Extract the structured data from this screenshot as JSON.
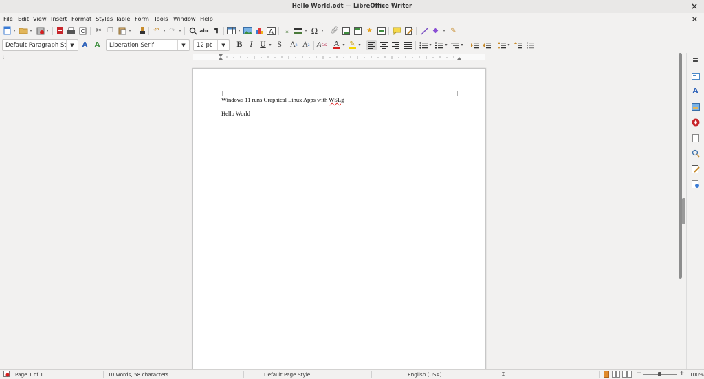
{
  "window": {
    "title": "Hello World.odt — LibreOffice Writer",
    "close_glyph": "×"
  },
  "menu": {
    "items": [
      "File",
      "Edit",
      "View",
      "Insert",
      "Format",
      "Styles",
      "Table",
      "Form",
      "Tools",
      "Window",
      "Help"
    ],
    "doc_close_glyph": "×"
  },
  "toolbar_formatting": {
    "paragraph_style": "Default Paragraph Style",
    "font_name": "Liberation Serif",
    "font_size": "12 pt"
  },
  "document": {
    "lines": [
      "Windows 11 runs Graphical Linux Apps with ",
      "WSLg",
      "Hello World"
    ]
  },
  "status": {
    "page": "Page 1 of 1",
    "word_count": "10 words, 58 characters",
    "page_style": "Default Page Style",
    "language": "English (USA)",
    "zoom": "100%",
    "zoom_minus": "−",
    "zoom_plus": "+"
  },
  "colors": {
    "font_color": "#d62020",
    "highlight_color": "#f5d400",
    "accent": "#1e6fc4"
  },
  "icons": {
    "sidebar": [
      "properties-icon",
      "styles-icon",
      "gallery-icon",
      "navigator-icon",
      "page-icon",
      "style-inspector-icon",
      "manage-changes-icon",
      "design-icon"
    ]
  }
}
